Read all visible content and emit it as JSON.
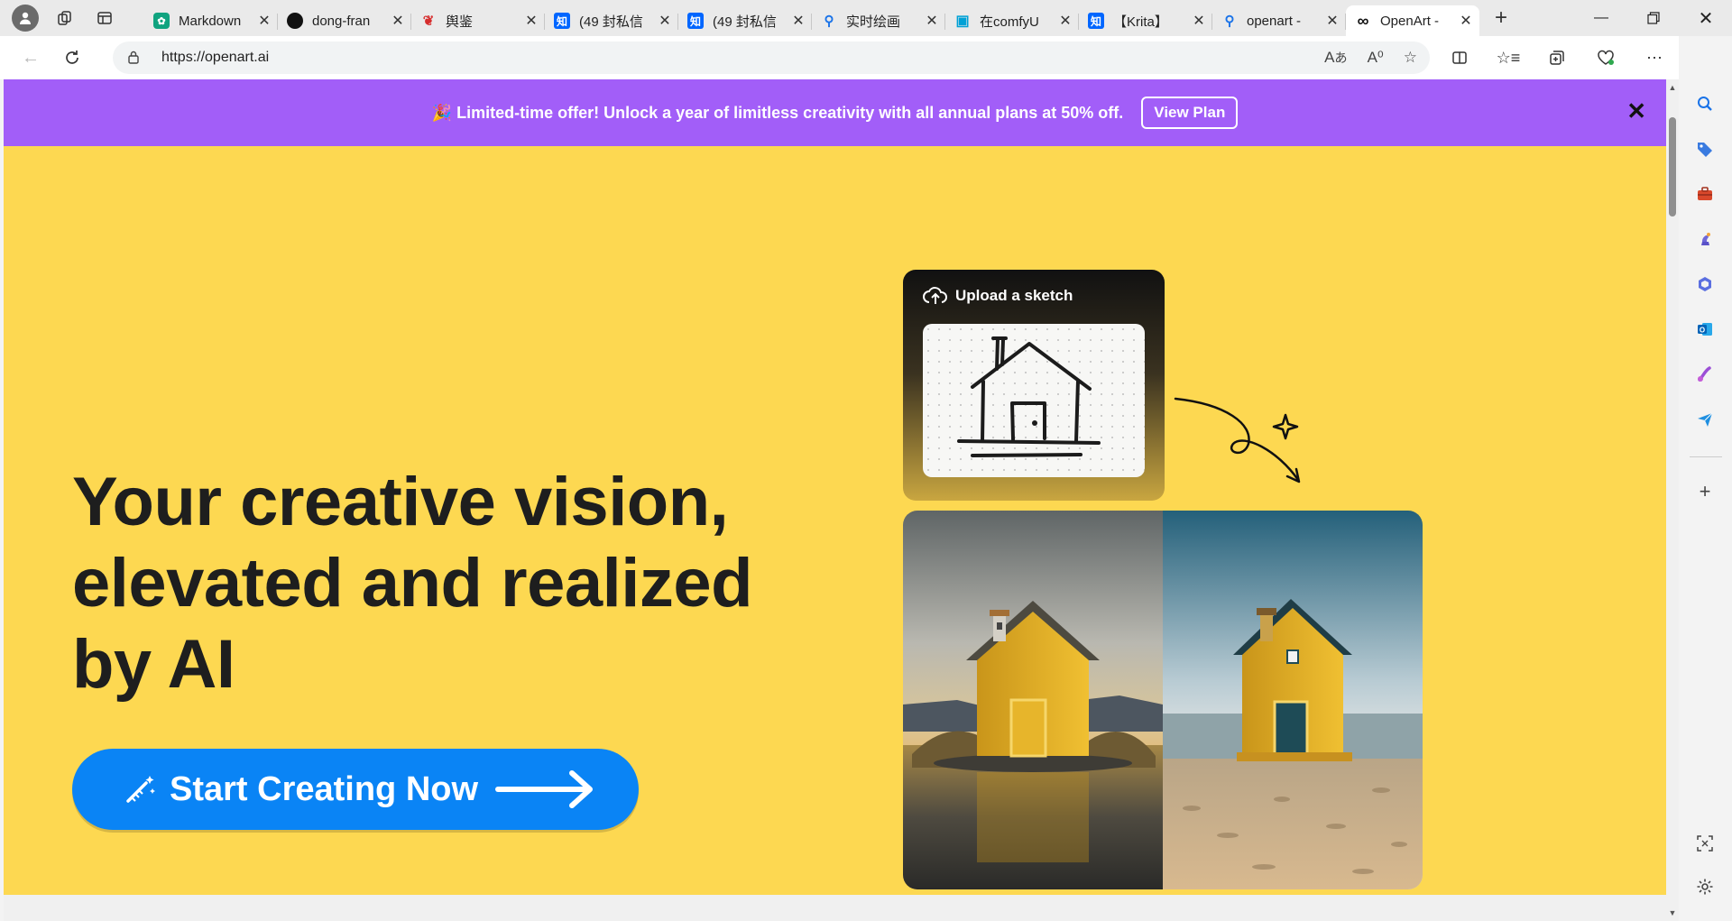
{
  "browser": {
    "tabs": [
      {
        "title": "Markdown",
        "favicon": "chatgpt-icon",
        "favicon_color": "#10a37f",
        "active": false
      },
      {
        "title": "dong-fran",
        "favicon": "github-icon",
        "favicon_color": "#111111",
        "active": false
      },
      {
        "title": "舆鉴",
        "favicon": "red-logo-icon",
        "favicon_color": "#d62d2d",
        "active": false
      },
      {
        "title": "(49 封私信",
        "favicon": "zhihu-icon",
        "favicon_color": "#0066ff",
        "active": false
      },
      {
        "title": "(49 封私信",
        "favicon": "zhihu-icon",
        "favicon_color": "#0066ff",
        "active": false
      },
      {
        "title": "实时绘画",
        "favicon": "search-icon",
        "favicon_color": "#1a73e8",
        "active": false
      },
      {
        "title": "在comfyU",
        "favicon": "bilibili-icon",
        "favicon_color": "#00a1d6",
        "active": false
      },
      {
        "title": "【Krita】",
        "favicon": "zhihu-icon",
        "favicon_color": "#0066ff",
        "active": false
      },
      {
        "title": "openart -",
        "favicon": "search-icon",
        "favicon_color": "#1a73e8",
        "active": false
      },
      {
        "title": "OpenArt -",
        "favicon": "openart-icon",
        "favicon_color": "#111111",
        "active": true
      }
    ],
    "url": "https://openart.ai"
  },
  "promo": {
    "emoji": "🎉",
    "text": "Limited-time offer! Unlock a year of limitless creativity with all annual plans at 50% off.",
    "button": "View Plan"
  },
  "hero": {
    "headline": [
      "Your creative vision,",
      "elevated and realized",
      "by AI"
    ],
    "cta": "Start Creating Now",
    "sketch_label": "Upload a sketch",
    "carousel": {
      "count": 3,
      "active": 0
    }
  },
  "colors": {
    "promo_bg": "#a25ef8",
    "hero_bg": "#fdd851",
    "cta_bg": "#0a84f5"
  }
}
